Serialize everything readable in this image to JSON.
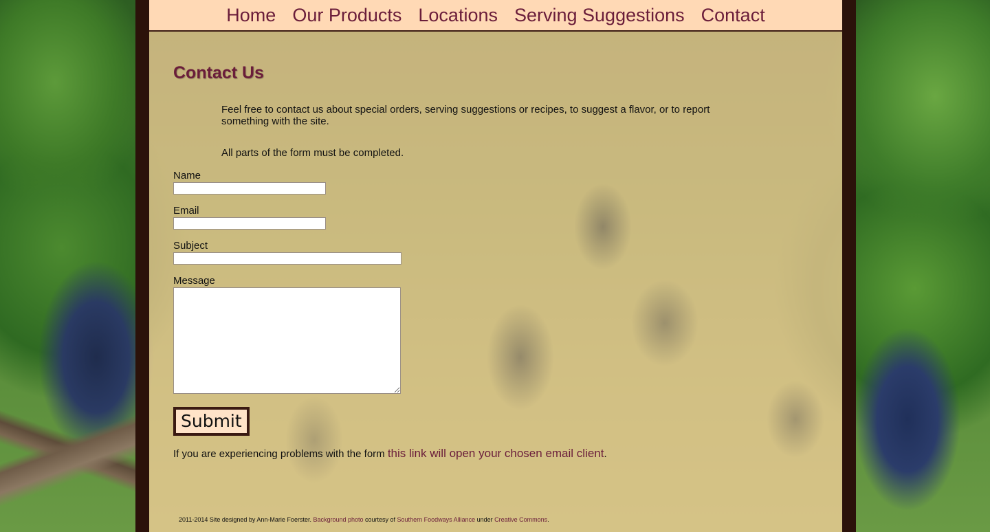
{
  "nav": {
    "items": [
      "Home",
      "Our Products",
      "Locations",
      "Serving Suggestions",
      "Contact"
    ]
  },
  "page": {
    "title": "Contact Us",
    "intro": "Feel free to contact us about special orders, serving suggestions or recipes, to suggest a flavor, or to report something with the site.",
    "requirement": "All parts of the form must be completed."
  },
  "form": {
    "name_label": "Name",
    "name_value": "",
    "email_label": "Email",
    "email_value": "",
    "subject_label": "Subject",
    "subject_value": "",
    "message_label": "Message",
    "message_value": "",
    "submit_label": "Submit"
  },
  "help": {
    "prefix": "If you are experiencing problems with the form ",
    "link_text": "this link will open your chosen email client",
    "suffix": "."
  },
  "footer": {
    "text1": "2011-2014 Site designed by Ann-Marie Foerster. ",
    "link1": "Background photo",
    "text2": " courtesy of ",
    "link2": "Southern Foodways Alliance",
    "text3": " under ",
    "link3": "Creative Commons",
    "text4": "."
  },
  "colors": {
    "accent": "#6a1d3a",
    "nav_bg": "#ffd9b5",
    "stripe": "#2b120a"
  }
}
